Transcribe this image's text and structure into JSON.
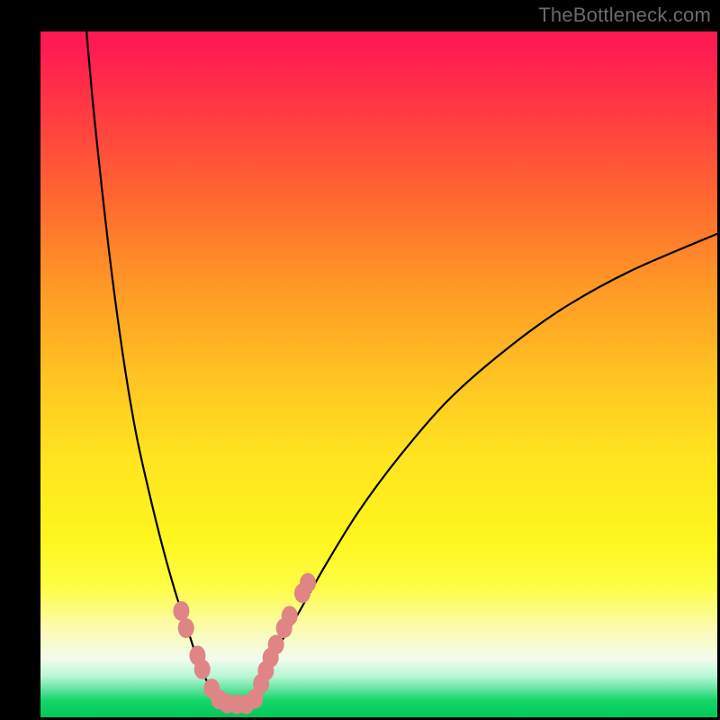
{
  "watermark": "TheBottleneck.com",
  "gradient": {
    "top_color": "#ff1a52",
    "mid_color": "#ffe41f",
    "bottom_color": "#00c85a"
  },
  "chart_data": {
    "type": "line",
    "title": "",
    "xlabel": "",
    "ylabel": "",
    "xlim": [
      0,
      100
    ],
    "ylim": [
      0,
      100
    ],
    "x_axis_note": "horizontal position across plot (percent)",
    "y_axis_note": "approximate curve height from bottom (percent of plot height)",
    "series": [
      {
        "name": "left-curve",
        "x": [
          6.8,
          8,
          10,
          12,
          14,
          16,
          18,
          20,
          22,
          23,
          24,
          25,
          26,
          27
        ],
        "values": [
          100,
          87,
          69,
          54,
          42,
          33,
          25,
          18,
          12,
          9,
          6.5,
          4.5,
          3,
          2
        ]
      },
      {
        "name": "right-curve",
        "x": [
          31,
          33,
          35,
          38,
          42,
          47,
          53,
          60,
          68,
          77,
          87,
          100
        ],
        "values": [
          2,
          6,
          10,
          15,
          22,
          30,
          38,
          46,
          53,
          59.5,
          65,
          70.5
        ]
      },
      {
        "name": "flat-bottom",
        "x": [
          27,
          28.5,
          30,
          31
        ],
        "values": [
          2,
          1.8,
          1.8,
          2
        ]
      }
    ],
    "markers": {
      "name": "pink-beads",
      "points": [
        {
          "x": 20.8,
          "y": 15.5
        },
        {
          "x": 21.5,
          "y": 13.0
        },
        {
          "x": 23.2,
          "y": 9.0
        },
        {
          "x": 23.9,
          "y": 7.0
        },
        {
          "x": 25.3,
          "y": 4.2
        },
        {
          "x": 26.4,
          "y": 2.6
        },
        {
          "x": 27.6,
          "y": 2.0
        },
        {
          "x": 29.0,
          "y": 1.9
        },
        {
          "x": 30.4,
          "y": 1.9
        },
        {
          "x": 31.7,
          "y": 2.7
        },
        {
          "x": 32.6,
          "y": 4.9
        },
        {
          "x": 33.3,
          "y": 6.8
        },
        {
          "x": 34.0,
          "y": 8.7
        },
        {
          "x": 34.8,
          "y": 10.6
        },
        {
          "x": 36.0,
          "y": 13.0
        },
        {
          "x": 36.8,
          "y": 14.8
        },
        {
          "x": 38.7,
          "y": 18.1
        },
        {
          "x": 39.5,
          "y": 19.6
        }
      ],
      "rx": 9,
      "ry": 11,
      "color": "#e08585"
    }
  }
}
